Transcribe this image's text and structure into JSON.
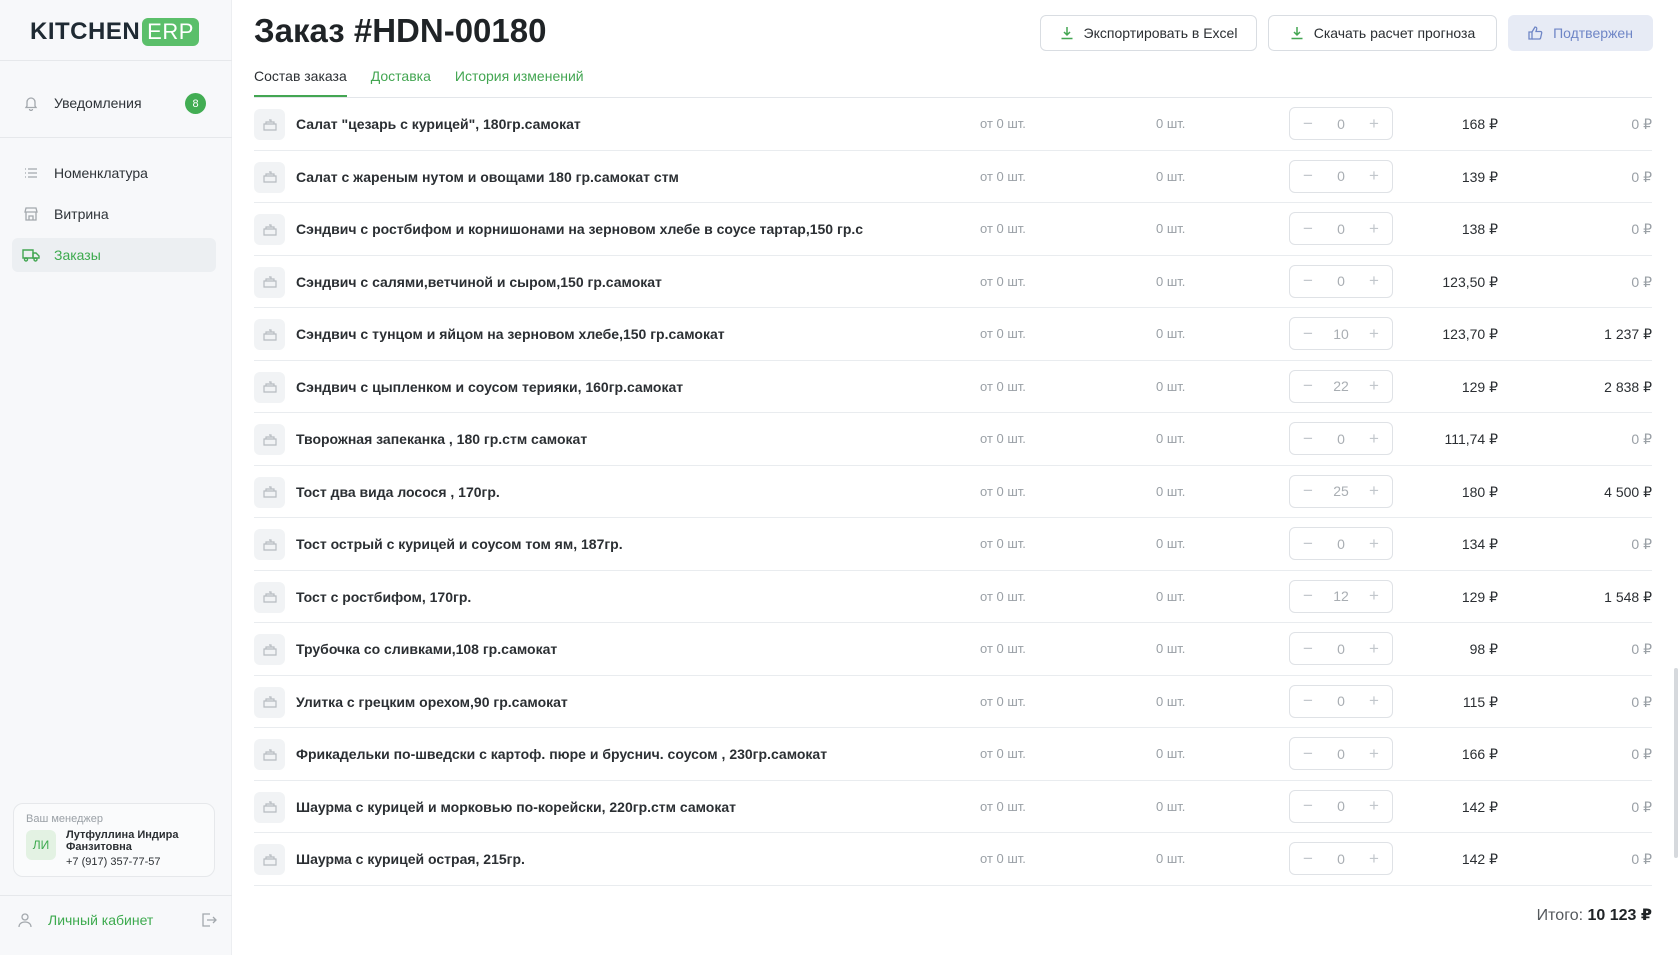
{
  "brand": {
    "main": "KITCHEN",
    "tag": "ERP"
  },
  "sidebar": {
    "notifications": {
      "label": "Уведомления",
      "count": "8"
    },
    "items": [
      {
        "label": "Номенклатура",
        "icon": "list-icon"
      },
      {
        "label": "Витрина",
        "icon": "store-icon"
      },
      {
        "label": "Заказы",
        "icon": "truck-icon",
        "active": true
      }
    ],
    "manager": {
      "caption": "Ваш менеджер",
      "initials": "ЛИ",
      "name": "Лутфуллина Индира Фанзитовна",
      "phone": "+7 (917) 357-77-57"
    },
    "cabinet": "Личный кабинет"
  },
  "header": {
    "title": "Заказ #HDN-00180",
    "export_label": "Экспортировать в Excel",
    "forecast_label": "Скачать расчет прогноза",
    "status_label": "Подтвержен"
  },
  "tabs": [
    "Состав заказа",
    "Доставка",
    "История изменений"
  ],
  "rows": [
    {
      "name": "Салат \"цезарь с курицей\", 180гр.самокат",
      "min": "от 0 шт.",
      "stock": "0 шт.",
      "qty": "0",
      "price": "168 ₽",
      "sum": "0 ₽"
    },
    {
      "name": "Салат с жареным нутом и овощами 180 гр.самокат стм",
      "min": "от 0 шт.",
      "stock": "0 шт.",
      "qty": "0",
      "price": "139 ₽",
      "sum": "0 ₽"
    },
    {
      "name": "Сэндвич с ростбифом и корнишонами на зерновом хлебе в соусе тартар,150 гр.с",
      "min": "от 0 шт.",
      "stock": "0 шт.",
      "qty": "0",
      "price": "138 ₽",
      "sum": "0 ₽"
    },
    {
      "name": "Сэндвич с салями,ветчиной и сыром,150 гр.самокат",
      "min": "от 0 шт.",
      "stock": "0 шт.",
      "qty": "0",
      "price": "123,50 ₽",
      "sum": "0 ₽"
    },
    {
      "name": "Сэндвич с тунцом и яйцом на зерновом хлебе,150 гр.самокат",
      "min": "от 0 шт.",
      "stock": "0 шт.",
      "qty": "10",
      "price": "123,70 ₽",
      "sum": "1 237 ₽"
    },
    {
      "name": "Сэндвич с цыпленком и соусом терияки, 160гр.самокат",
      "min": "от 0 шт.",
      "stock": "0 шт.",
      "qty": "22",
      "price": "129 ₽",
      "sum": "2 838 ₽"
    },
    {
      "name": "Творожная запеканка , 180 гр.стм самокат",
      "min": "от 0 шт.",
      "stock": "0 шт.",
      "qty": "0",
      "price": "111,74 ₽",
      "sum": "0 ₽"
    },
    {
      "name": "Тост два вида лосося , 170гр.",
      "min": "от 0 шт.",
      "stock": "0 шт.",
      "qty": "25",
      "price": "180 ₽",
      "sum": "4 500 ₽"
    },
    {
      "name": "Тост острый с курицей и соусом том ям, 187гр.",
      "min": "от 0 шт.",
      "stock": "0 шт.",
      "qty": "0",
      "price": "134 ₽",
      "sum": "0 ₽"
    },
    {
      "name": "Тост с ростбифом, 170гр.",
      "min": "от 0 шт.",
      "stock": "0 шт.",
      "qty": "12",
      "price": "129 ₽",
      "sum": "1 548 ₽"
    },
    {
      "name": "Трубочка со сливками,108 гр.самокат",
      "min": "от 0 шт.",
      "stock": "0 шт.",
      "qty": "0",
      "price": "98 ₽",
      "sum": "0 ₽"
    },
    {
      "name": "Улитка с грецким орехом,90 гр.самокат",
      "min": "от 0 шт.",
      "stock": "0 шт.",
      "qty": "0",
      "price": "115 ₽",
      "sum": "0 ₽"
    },
    {
      "name": "Фрикадельки по-шведски с картоф. пюре и бруснич. соусом , 230гр.самокат",
      "min": "от 0 шт.",
      "stock": "0 шт.",
      "qty": "0",
      "price": "166 ₽",
      "sum": "0 ₽"
    },
    {
      "name": "Шаурма с курицей и морковью по-корейски, 220гр.стм самокат",
      "min": "от 0 шт.",
      "stock": "0 шт.",
      "qty": "0",
      "price": "142 ₽",
      "sum": "0 ₽"
    },
    {
      "name": "Шаурма с курицей острая, 215гр.",
      "min": "от 0 шт.",
      "stock": "0 шт.",
      "qty": "0",
      "price": "142 ₽",
      "sum": "0 ₽"
    }
  ],
  "total": {
    "label": "Итого:",
    "value": "10 123 ₽"
  },
  "colors": {
    "accent": "#43a652",
    "primary_button_bg": "#e7ebf5",
    "primary_button_text": "#6f86c6"
  }
}
